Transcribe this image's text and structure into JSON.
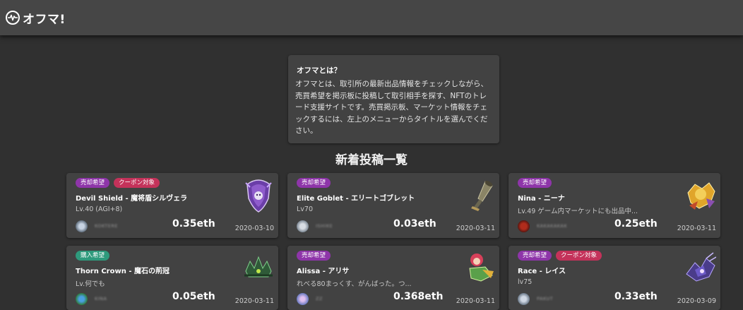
{
  "app": {
    "title": "オフマ!",
    "logo_icon": "heartbeat-circle-icon"
  },
  "about": {
    "title": "オフマとは？",
    "body": "オフマとは、取引所の最新出品情報をチェックしながら、売買希望を掲示板に投稿して取引相手を探す、NFTのトレード支援サイトです。売買掲示板、マーケット情報をチェックするには、左上のメニューからタイトルを選んでください。"
  },
  "section": {
    "title": "新着投稿一覧"
  },
  "colors": {
    "sell": "#8e35a9",
    "buy": "#2e9a7c",
    "coupon": "#c4325a",
    "background": "#303030",
    "card": "#424242"
  },
  "posts": [
    {
      "badges": [
        "売却希望",
        "クーポン対象"
      ],
      "title": "Devil Shield - 魔将盾シルヴェラ",
      "desc": "Lv.40 (AGI+8)",
      "user": "KOKTERE",
      "price": "0.35eth",
      "date": "2020-03-10",
      "image_icon": "devil-shield-item-icon"
    },
    {
      "badges": [
        "売却希望"
      ],
      "title": "Elite Goblet - エリートゴブレット",
      "desc": "Lv70",
      "user": "ISHIKE",
      "price": "0.03eth",
      "date": "2020-03-11",
      "image_icon": "goblet-item-icon"
    },
    {
      "badges": [
        "売却希望"
      ],
      "title": "Nina - ニーナ",
      "desc": "Lv.49 ゲーム内マーケットにも出品中...",
      "user": "KAKAKAKAK",
      "price": "0.25eth",
      "date": "2020-03-11",
      "image_icon": "nina-hero-icon"
    },
    {
      "badges": [
        "購入希望"
      ],
      "title": "Thorn Crown - 魔石の荊冠",
      "desc": "Lv.何でも",
      "user": "KINA",
      "price": "0.05eth",
      "date": "2020-03-11",
      "image_icon": "thorn-crown-item-icon"
    },
    {
      "badges": [
        "売却希望"
      ],
      "title": "Alissa - アリサ",
      "desc": "れべる80まっくす、がんばった。つ...",
      "user": "ZZ",
      "price": "0.368eth",
      "date": "2020-03-11",
      "image_icon": "alissa-hero-icon"
    },
    {
      "badges": [
        "売却希望",
        "クーポン対象"
      ],
      "title": "Race - レイス",
      "desc": "lv75",
      "user": "PAKUT",
      "price": "0.33eth",
      "date": "2020-03-09",
      "image_icon": "race-hero-icon"
    }
  ]
}
